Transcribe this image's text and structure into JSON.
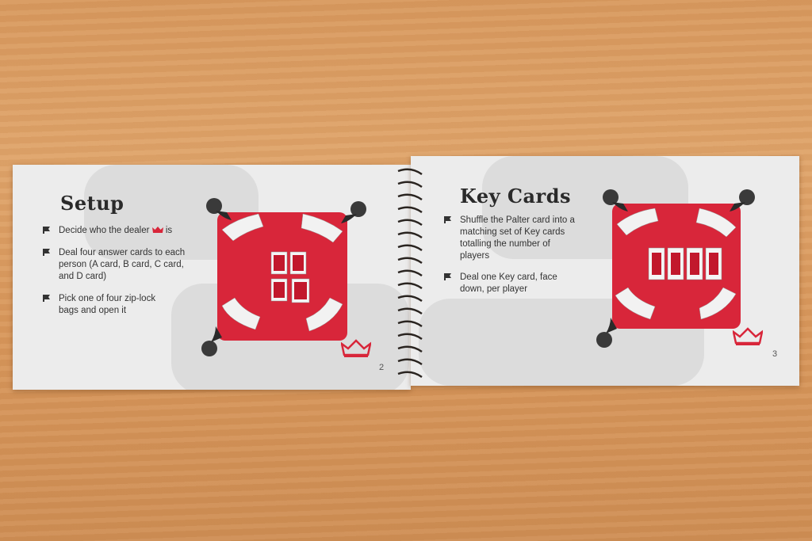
{
  "left_page": {
    "title": "Setup",
    "bullets": [
      "Decide who the dealer",
      "is",
      "Deal four answer cards to each person (A card, B card, C card, and D card)",
      "Pick one of four zip-lock bags and open it"
    ],
    "page_number": "2"
  },
  "right_page": {
    "title": "Key Cards",
    "bullets": [
      "Shuffle the Palter card into a matching set of Key cards totalling the number of players",
      "Deal one Key card, face down, per player"
    ],
    "page_number": "3"
  },
  "colors": {
    "board_red": "#d8263a",
    "crown_red": "#d8263a",
    "page": "#ececec"
  }
}
